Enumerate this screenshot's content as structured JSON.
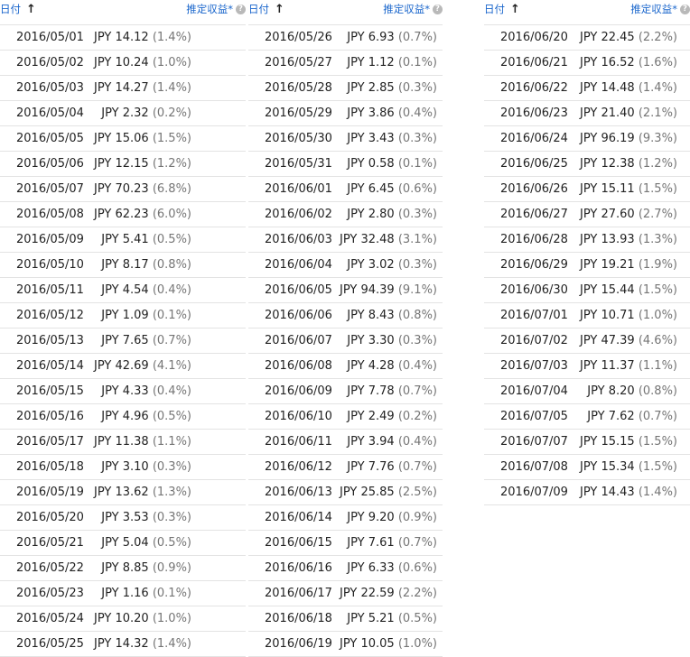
{
  "header": {
    "date_label": "日付",
    "sort_icon": "arrow-up-icon",
    "revenue_label": "推定収益*",
    "help_icon": "help-icon"
  },
  "columns": [
    {
      "rows": [
        {
          "date": "2016/05/01",
          "amount": "JPY 14.12",
          "pct": "(1.4%)"
        },
        {
          "date": "2016/05/02",
          "amount": "JPY 10.24",
          "pct": "(1.0%)"
        },
        {
          "date": "2016/05/03",
          "amount": "JPY 14.27",
          "pct": "(1.4%)"
        },
        {
          "date": "2016/05/04",
          "amount": "JPY 2.32",
          "pct": "(0.2%)"
        },
        {
          "date": "2016/05/05",
          "amount": "JPY 15.06",
          "pct": "(1.5%)"
        },
        {
          "date": "2016/05/06",
          "amount": "JPY 12.15",
          "pct": "(1.2%)"
        },
        {
          "date": "2016/05/07",
          "amount": "JPY 70.23",
          "pct": "(6.8%)"
        },
        {
          "date": "2016/05/08",
          "amount": "JPY 62.23",
          "pct": "(6.0%)"
        },
        {
          "date": "2016/05/09",
          "amount": "JPY 5.41",
          "pct": "(0.5%)"
        },
        {
          "date": "2016/05/10",
          "amount": "JPY 8.17",
          "pct": "(0.8%)"
        },
        {
          "date": "2016/05/11",
          "amount": "JPY 4.54",
          "pct": "(0.4%)"
        },
        {
          "date": "2016/05/12",
          "amount": "JPY 1.09",
          "pct": "(0.1%)"
        },
        {
          "date": "2016/05/13",
          "amount": "JPY 7.65",
          "pct": "(0.7%)"
        },
        {
          "date": "2016/05/14",
          "amount": "JPY 42.69",
          "pct": "(4.1%)"
        },
        {
          "date": "2016/05/15",
          "amount": "JPY 4.33",
          "pct": "(0.4%)"
        },
        {
          "date": "2016/05/16",
          "amount": "JPY 4.96",
          "pct": "(0.5%)"
        },
        {
          "date": "2016/05/17",
          "amount": "JPY 11.38",
          "pct": "(1.1%)"
        },
        {
          "date": "2016/05/18",
          "amount": "JPY 3.10",
          "pct": "(0.3%)"
        },
        {
          "date": "2016/05/19",
          "amount": "JPY 13.62",
          "pct": "(1.3%)"
        },
        {
          "date": "2016/05/20",
          "amount": "JPY 3.53",
          "pct": "(0.3%)"
        },
        {
          "date": "2016/05/21",
          "amount": "JPY 5.04",
          "pct": "(0.5%)"
        },
        {
          "date": "2016/05/22",
          "amount": "JPY 8.85",
          "pct": "(0.9%)"
        },
        {
          "date": "2016/05/23",
          "amount": "JPY 1.16",
          "pct": "(0.1%)"
        },
        {
          "date": "2016/05/24",
          "amount": "JPY 10.20",
          "pct": "(1.0%)"
        },
        {
          "date": "2016/05/25",
          "amount": "JPY 14.32",
          "pct": "(1.4%)"
        }
      ]
    },
    {
      "rows": [
        {
          "date": "2016/05/26",
          "amount": "JPY 6.93",
          "pct": "(0.7%)"
        },
        {
          "date": "2016/05/27",
          "amount": "JPY 1.12",
          "pct": "(0.1%)"
        },
        {
          "date": "2016/05/28",
          "amount": "JPY 2.85",
          "pct": "(0.3%)"
        },
        {
          "date": "2016/05/29",
          "amount": "JPY 3.86",
          "pct": "(0.4%)"
        },
        {
          "date": "2016/05/30",
          "amount": "JPY 3.43",
          "pct": "(0.3%)"
        },
        {
          "date": "2016/05/31",
          "amount": "JPY 0.58",
          "pct": "(0.1%)"
        },
        {
          "date": "2016/06/01",
          "amount": "JPY 6.45",
          "pct": "(0.6%)"
        },
        {
          "date": "2016/06/02",
          "amount": "JPY 2.80",
          "pct": "(0.3%)"
        },
        {
          "date": "2016/06/03",
          "amount": "JPY 32.48",
          "pct": "(3.1%)"
        },
        {
          "date": "2016/06/04",
          "amount": "JPY 3.02",
          "pct": "(0.3%)"
        },
        {
          "date": "2016/06/05",
          "amount": "JPY 94.39",
          "pct": "(9.1%)"
        },
        {
          "date": "2016/06/06",
          "amount": "JPY 8.43",
          "pct": "(0.8%)"
        },
        {
          "date": "2016/06/07",
          "amount": "JPY 3.30",
          "pct": "(0.3%)"
        },
        {
          "date": "2016/06/08",
          "amount": "JPY 4.28",
          "pct": "(0.4%)"
        },
        {
          "date": "2016/06/09",
          "amount": "JPY 7.78",
          "pct": "(0.7%)"
        },
        {
          "date": "2016/06/10",
          "amount": "JPY 2.49",
          "pct": "(0.2%)"
        },
        {
          "date": "2016/06/11",
          "amount": "JPY 3.94",
          "pct": "(0.4%)"
        },
        {
          "date": "2016/06/12",
          "amount": "JPY 7.76",
          "pct": "(0.7%)"
        },
        {
          "date": "2016/06/13",
          "amount": "JPY 25.85",
          "pct": "(2.5%)"
        },
        {
          "date": "2016/06/14",
          "amount": "JPY 9.20",
          "pct": "(0.9%)"
        },
        {
          "date": "2016/06/15",
          "amount": "JPY 7.61",
          "pct": "(0.7%)"
        },
        {
          "date": "2016/06/16",
          "amount": "JPY 6.33",
          "pct": "(0.6%)"
        },
        {
          "date": "2016/06/17",
          "amount": "JPY 22.59",
          "pct": "(2.2%)"
        },
        {
          "date": "2016/06/18",
          "amount": "JPY 5.21",
          "pct": "(0.5%)"
        },
        {
          "date": "2016/06/19",
          "amount": "JPY 10.05",
          "pct": "(1.0%)"
        }
      ]
    },
    {
      "rows": [
        {
          "date": "2016/06/20",
          "amount": "JPY 22.45",
          "pct": "(2.2%)"
        },
        {
          "date": "2016/06/21",
          "amount": "JPY 16.52",
          "pct": "(1.6%)"
        },
        {
          "date": "2016/06/22",
          "amount": "JPY 14.48",
          "pct": "(1.4%)"
        },
        {
          "date": "2016/06/23",
          "amount": "JPY 21.40",
          "pct": "(2.1%)"
        },
        {
          "date": "2016/06/24",
          "amount": "JPY 96.19",
          "pct": "(9.3%)"
        },
        {
          "date": "2016/06/25",
          "amount": "JPY 12.38",
          "pct": "(1.2%)"
        },
        {
          "date": "2016/06/26",
          "amount": "JPY 15.11",
          "pct": "(1.5%)"
        },
        {
          "date": "2016/06/27",
          "amount": "JPY 27.60",
          "pct": "(2.7%)"
        },
        {
          "date": "2016/06/28",
          "amount": "JPY 13.93",
          "pct": "(1.3%)"
        },
        {
          "date": "2016/06/29",
          "amount": "JPY 19.21",
          "pct": "(1.9%)"
        },
        {
          "date": "2016/06/30",
          "amount": "JPY 15.44",
          "pct": "(1.5%)"
        },
        {
          "date": "2016/07/01",
          "amount": "JPY 10.71",
          "pct": "(1.0%)"
        },
        {
          "date": "2016/07/02",
          "amount": "JPY 47.39",
          "pct": "(4.6%)"
        },
        {
          "date": "2016/07/03",
          "amount": "JPY 11.37",
          "pct": "(1.1%)"
        },
        {
          "date": "2016/07/04",
          "amount": "JPY 8.20",
          "pct": "(0.8%)"
        },
        {
          "date": "2016/07/05",
          "amount": "JPY 7.62",
          "pct": "(0.7%)"
        },
        {
          "date": "2016/07/07",
          "amount": "JPY 15.15",
          "pct": "(1.5%)"
        },
        {
          "date": "2016/07/08",
          "amount": "JPY 15.34",
          "pct": "(1.5%)"
        },
        {
          "date": "2016/07/09",
          "amount": "JPY 14.43",
          "pct": "(1.4%)"
        }
      ]
    }
  ]
}
